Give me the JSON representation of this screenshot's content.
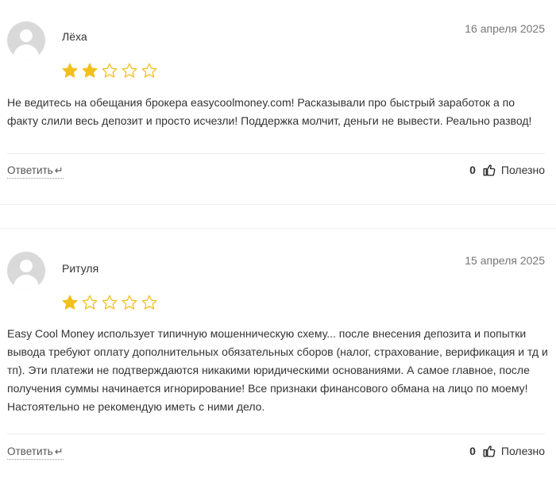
{
  "reviews": [
    {
      "author": "Лёха",
      "date": "16 апреля 2025",
      "rating": 2,
      "max_rating": 5,
      "text": "Не ведитесь на обещания брокера easycoolmoney.com! Расказывали про быстрый заработок а по факту слили весь депозит и просто исчезли! Поддержка молчит, деньги не вывести. Реально развод!",
      "reply_label": "Ответить",
      "likes": "0",
      "helpful_label": "Полезно"
    },
    {
      "author": "Ритуля",
      "date": "15 апреля 2025",
      "rating": 1,
      "max_rating": 5,
      "text": "Easy Cool Money использует типичную мошенническую схему... после внесения депозита и попытки вывода требуют оплату дополнительных обязательных сборов (налог, страхование, верификация и тд и тп). Эти платежи не подтверждаются никакими юридическими основаниями. А самое главное, после получения суммы начинается игнорирование! Все признаки финансового обмана на лицо по моему! Настоятельно не рекомендую иметь с ними дело.",
      "reply_label": "Ответить",
      "likes": "0",
      "helpful_label": "Полезно"
    }
  ],
  "colors": {
    "star_filled": "#f2c01e",
    "star_empty_stroke": "#f2c01e",
    "text": "#333333",
    "date": "#777777"
  }
}
